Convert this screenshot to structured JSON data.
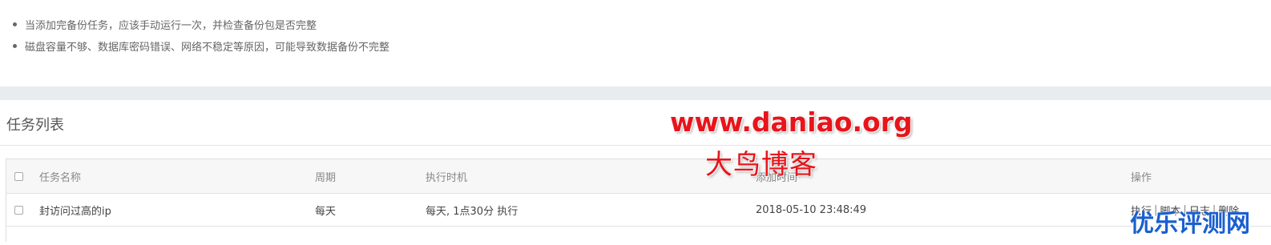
{
  "notes": [
    "当添加完备份任务，应该手动运行一次，并检查备份包是否完整",
    "磁盘容量不够、数据库密码错误、网络不稳定等原因，可能导致数据备份不完整"
  ],
  "panel": {
    "title": "任务列表"
  },
  "table": {
    "headers": {
      "name": "任务名称",
      "cycle": "周期",
      "exec_time": "执行时机",
      "added_time": "添加时间",
      "actions": "操作"
    },
    "rows": [
      {
        "name": "封访问过高的ip",
        "cycle": "每天",
        "exec_time": "每天, 1点30分 执行",
        "added_time": "2018-05-10 23:48:49",
        "actions": [
          "执行",
          "脚本",
          "日志",
          "删除"
        ]
      }
    ]
  },
  "watermarks": {
    "url": "www.daniao.org",
    "name": "大鸟博客",
    "corner": "优乐评测网"
  },
  "colors": {
    "action_link": "#20a53a",
    "watermark_red": "#e8141b",
    "watermark_blue": "#1a5fd0",
    "gap": "#e9ecef"
  }
}
